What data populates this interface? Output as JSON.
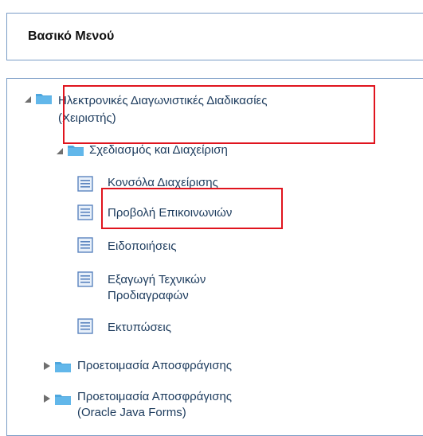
{
  "menu": {
    "title": "Βασικό Μενού"
  },
  "tree": {
    "root": {
      "label_line1": "Ηλεκτρονικές Διαγωνιστικές Διαδικασίες",
      "label_line2": "(Χειριστής)"
    },
    "planning": {
      "label": "Σχεδιασμός και Διαχείριση"
    },
    "items": [
      {
        "label": "Κονσόλα Διαχείρισης"
      },
      {
        "label": "Προβολή Επικοινωνιών"
      },
      {
        "label": "Ειδοποιήσεις"
      },
      {
        "label_line1": "Εξαγωγή Τεχνικών",
        "label_line2": "Προδιαγραφών"
      },
      {
        "label": "Εκτυπώσεις"
      }
    ],
    "unsealing_prep": {
      "label": "Προετοιμασία Αποσφράγισης"
    },
    "unsealing_prep_forms": {
      "label_line1": "Προετοιμασία Αποσφράγισης",
      "label_line2": "(Oracle Java Forms)"
    }
  },
  "colors": {
    "folder": "#4da6dd",
    "highlight": "#e0141e",
    "border": "#7a9cc6"
  }
}
